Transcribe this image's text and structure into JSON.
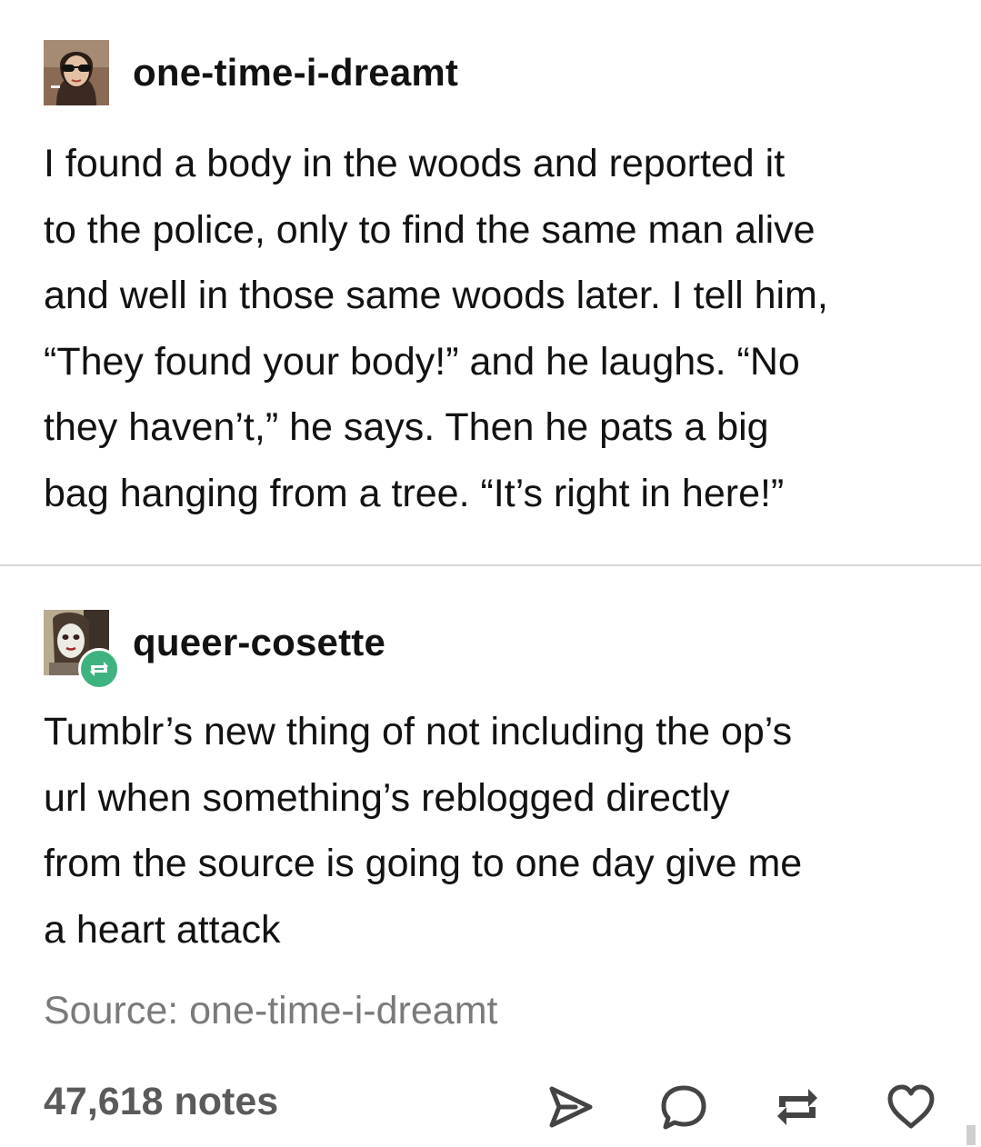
{
  "original_post": {
    "username": "one-time-i-dreamt",
    "avatar_icon": "user-avatar-sunglasses",
    "text": "I found a body in the woods and reported it\nto the police, only to find the same man alive\nand well in those same woods later. I tell him,\n“They found your body!” and he laughs. “No\nthey haven’t,” he says. Then he pats a big\nbag hanging from a tree. “It’s right in here!”"
  },
  "reblog": {
    "username": "queer-cosette",
    "avatar_icon": "user-avatar-pale-face",
    "badge_icon": "reblog-icon",
    "badge_color": "#3fb37f",
    "text": "Tumblr’s new thing of not including the op’s\nurl when something’s reblogged directly\nfrom the source is going to one day give me\na heart attack"
  },
  "source": {
    "label": "Source: one-time-i-dreamt"
  },
  "footer": {
    "notes": "47,618 notes",
    "actions": [
      "share-icon",
      "reply-icon",
      "reblog-icon",
      "like-icon"
    ]
  }
}
